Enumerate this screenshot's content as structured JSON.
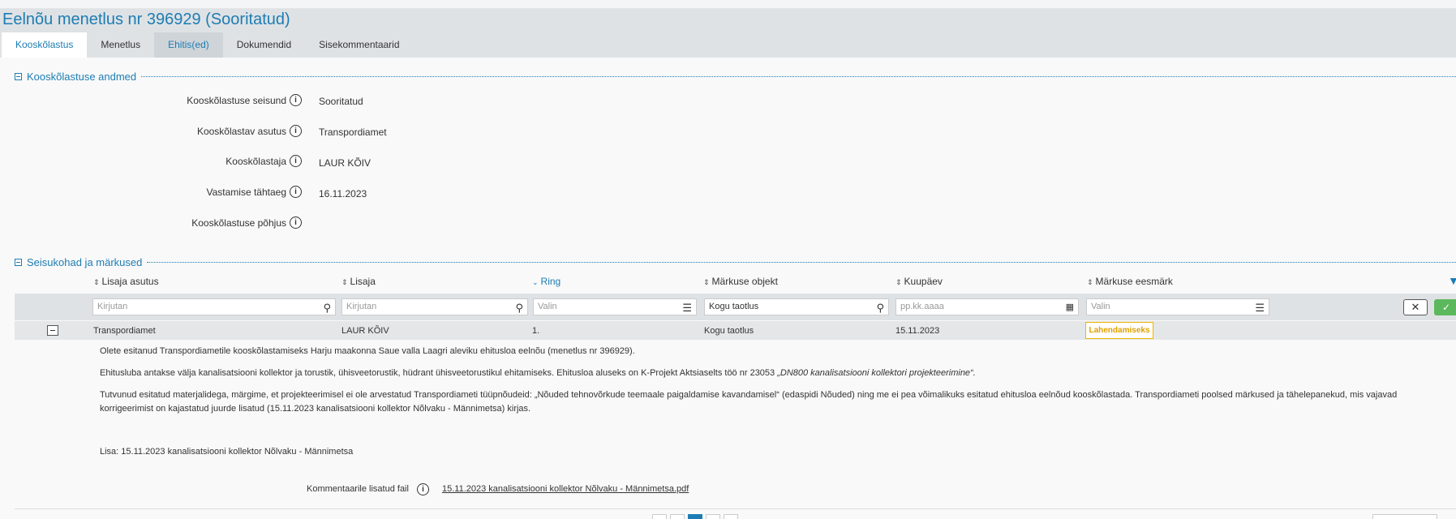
{
  "page_title": "Eelnõu menetlus nr 396929 (Sooritatud)",
  "tabs": [
    {
      "label": "Kooskõlastus"
    },
    {
      "label": "Menetlus"
    },
    {
      "label": "Ehitis(ed)"
    },
    {
      "label": "Dokumendid"
    },
    {
      "label": "Sisekommentaarid"
    }
  ],
  "section1": {
    "title": "Kooskõlastuse andmed",
    "fields": [
      {
        "label": "Kooskõlastuse seisund",
        "value": "Sooritatud"
      },
      {
        "label": "Kooskõlastav asutus",
        "value": "Transpordiamet"
      },
      {
        "label": "Kooskõlastaja",
        "value": "LAUR KÕIV"
      },
      {
        "label": "Vastamise tähtaeg",
        "value": "16.11.2023"
      },
      {
        "label": "Kooskõlastuse põhjus",
        "value": ""
      }
    ]
  },
  "section2": {
    "title": "Seisukohad ja märkused",
    "columns": [
      {
        "label": "Lisaja asutus"
      },
      {
        "label": "Lisaja"
      },
      {
        "label": "Ring"
      },
      {
        "label": "Märkuse objekt"
      },
      {
        "label": "Kuupäev"
      },
      {
        "label": "Märkuse eesmärk"
      }
    ],
    "filters": [
      {
        "placeholder": "Kirjutan"
      },
      {
        "placeholder": "Kirjutan"
      },
      {
        "placeholder": "Valin"
      },
      {
        "value": "Kogu taotlus"
      },
      {
        "placeholder": "pp.kk.aaaa"
      },
      {
        "placeholder": "Valin"
      }
    ],
    "row": {
      "asutus": "Transpordiamet",
      "lisaja": "LAUR KÕIV",
      "ring": "1.",
      "objekt": "Kogu taotlus",
      "kuupaev": "15.11.2023",
      "eesmark": "Lahendamiseks"
    },
    "comment": {
      "p1": "Olete esitanud Transpordiametile kooskõlastamiseks Harju maakonna Saue valla Laagri aleviku ehitusloa eelnõu (menetlus nr 396929).",
      "p2_pre": "Ehitusluba antakse välja kanalisatsiooni kollektor ja torustik, ühisveetorustik, hüdrant ühisveetorustikul ehitamiseks. Ehitusloa aluseks on K-Projekt Aktsiaselts töö nr 23053 ",
      "p2_em": "„DN800 kanalisatsiooni kollektori projekteerimine“.",
      "p3": "Tutvunud esitatud materjalidega, märgime, et projekteerimisel ei ole arvestatud Transpordiameti tüüpnõudeid: „Nõuded tehnovõrkude teemaale paigaldamise kavandamisel“ (edaspidi Nõuded) ning me ei pea võimalikuks esitatud ehitusloa eelnõud kooskõlastada. Transpordiameti poolsed märkused ja tähelepanekud, mis vajavad korrigeerimist on kajastatud juurde lisatud (15.11.2023 kanalisatsiooni kollektor Nõlvaku - Männimetsa) kirjas.",
      "p4": "Lisa: 15.11.2023 kanalisatsiooni kollektor Nõlvaku - Männimetsa"
    },
    "attachment": {
      "label": "Kommentaarile lisatud fail",
      "file": "15.11.2023 kanalisatsiooni kollektor Nõlvaku - Männimetsa.pdf"
    }
  },
  "colors": {
    "accent": "#1d7db3",
    "badge": "#f0b400",
    "ok": "#5cb85c"
  }
}
